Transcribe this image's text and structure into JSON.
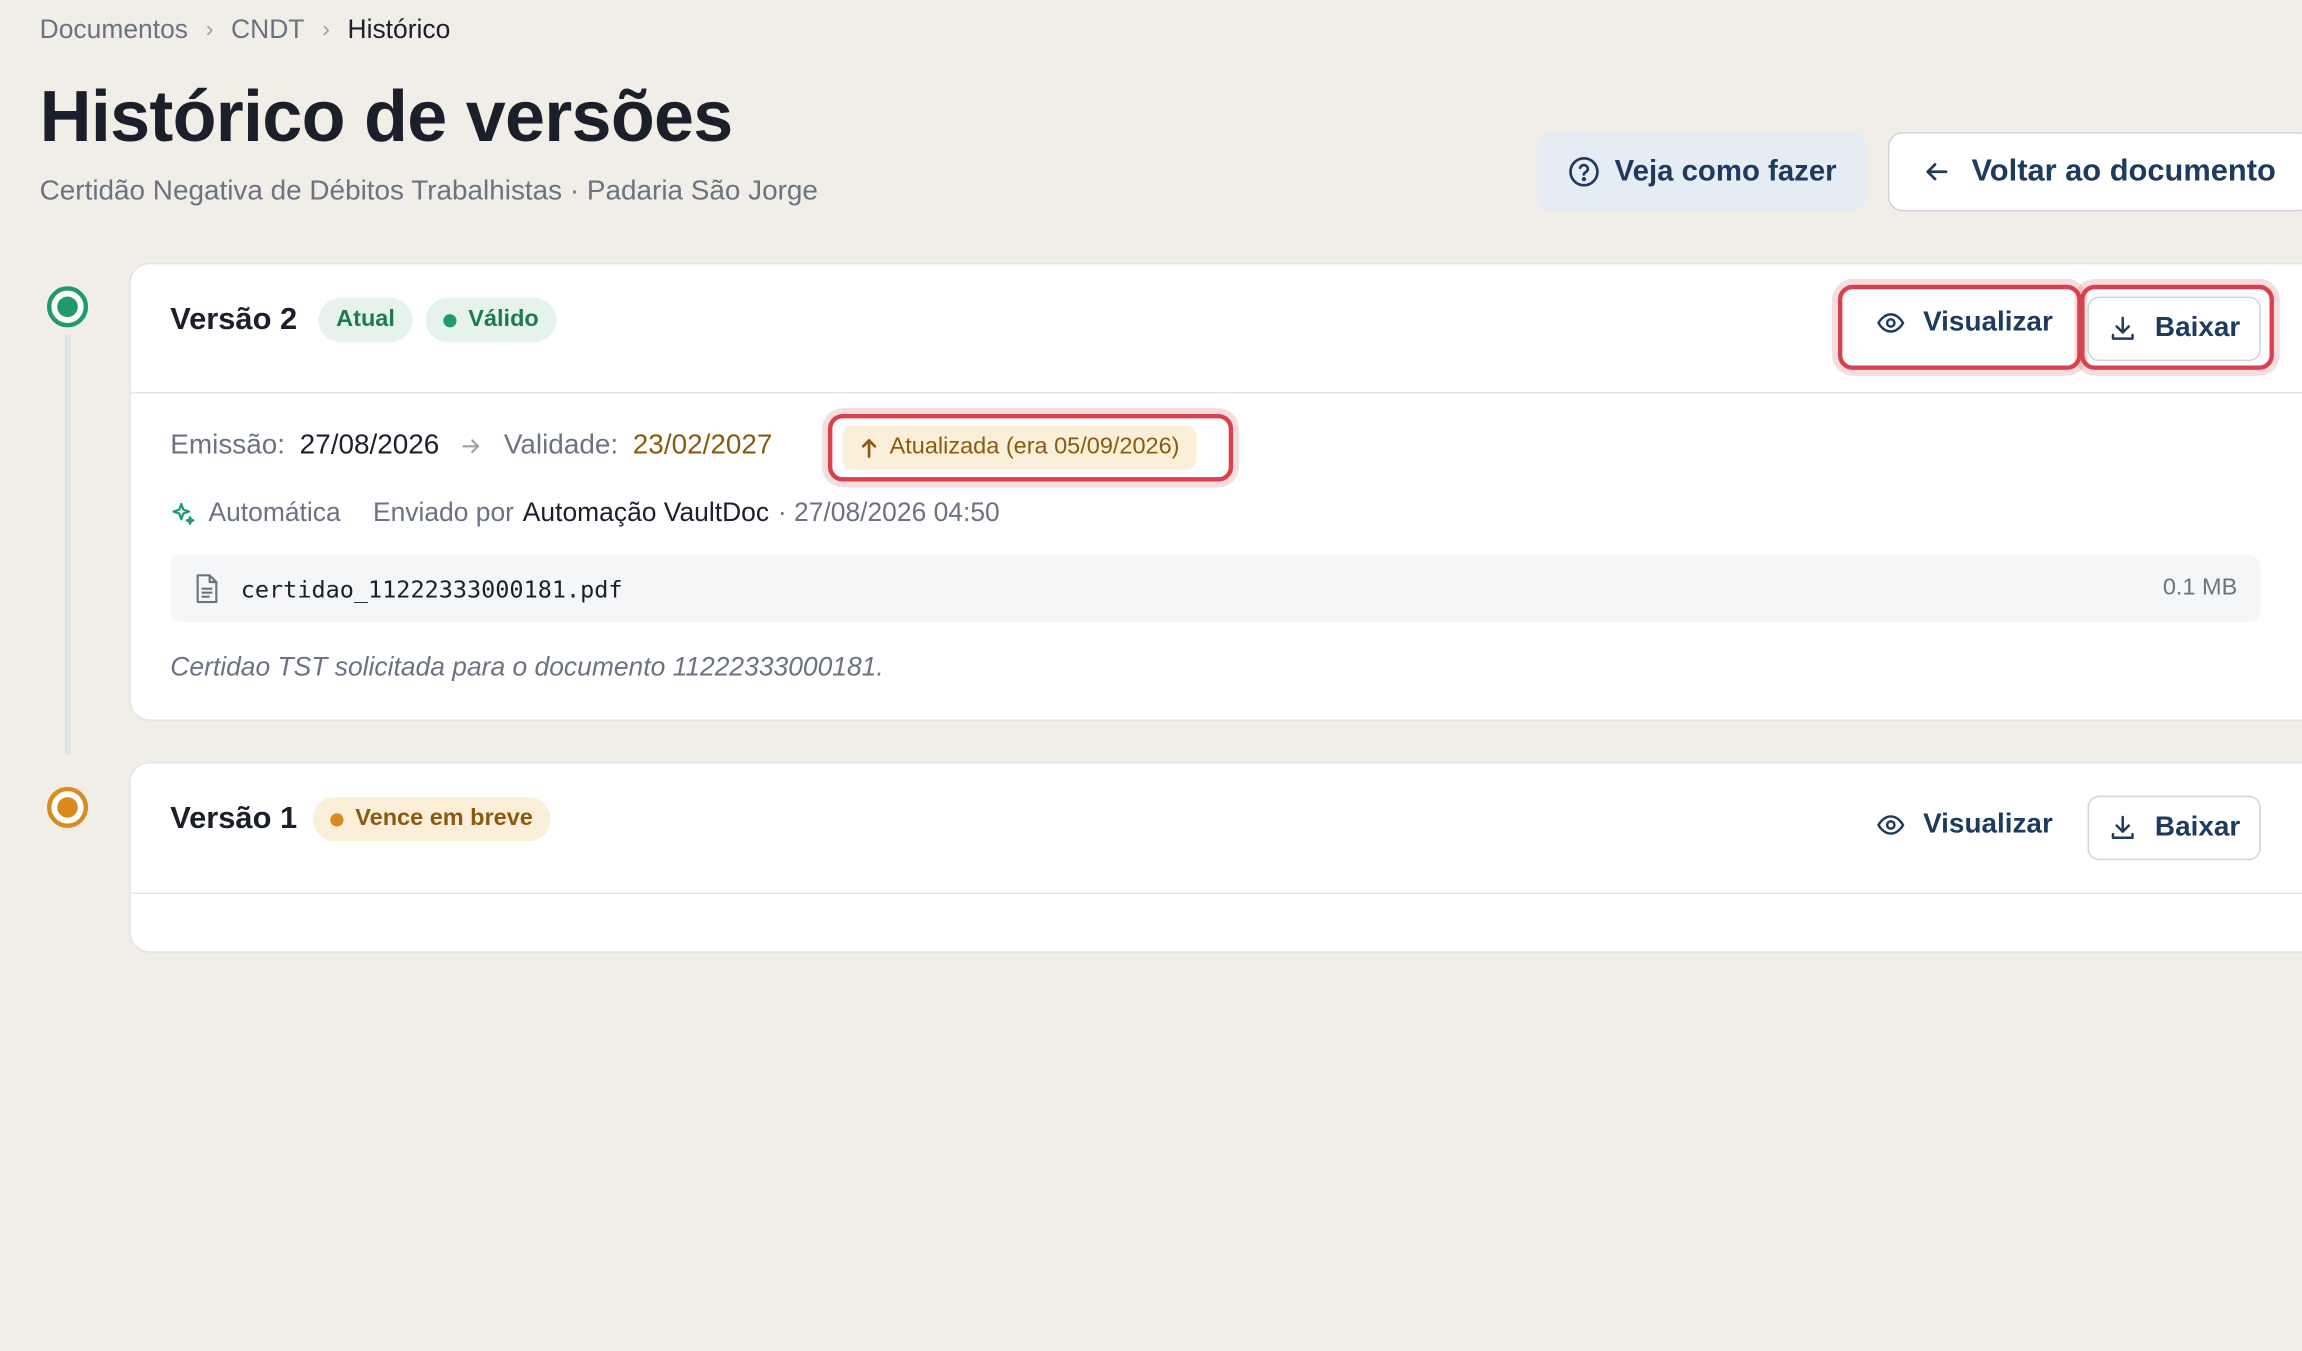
{
  "breadcrumb": {
    "items": [
      "Documentos",
      "CNDT",
      "Histórico"
    ],
    "separator": "›"
  },
  "page": {
    "title": "Histórico de versões",
    "subtitle": "Certidão Negativa de Débitos Trabalhistas · Padaria São Jorge"
  },
  "header_actions": {
    "help_label": "Veja como fazer",
    "back_label": "Voltar ao documento",
    "help_icon": "question-circle-icon",
    "back_icon": "arrow-left-icon"
  },
  "versions": [
    {
      "title": "Versão 2",
      "badges": {
        "current": "Atual",
        "status": "Válido"
      },
      "actions": {
        "view": "Visualizar",
        "download": "Baixar"
      },
      "emission_label": "Emissão:",
      "emission_value": "27/08/2026",
      "validity_label": "Validade:",
      "validity_value": "23/02/2027",
      "update_badge": "Atualizada (era 05/09/2026)",
      "mode": "Automática",
      "sent_by_label": "Enviado por",
      "sent_by": "Automação VaultDoc",
      "sent_at": "· 27/08/2026 04:50",
      "file_name": "certidao_11222333000181.pdf",
      "file_size": "0.1 MB",
      "note": "Certidao TST solicitada para o documento 11222333000181."
    },
    {
      "title": "Versão 1",
      "badges": {
        "status": "Vence em breve"
      },
      "actions": {
        "view": "Visualizar",
        "download": "Baixar"
      }
    }
  ],
  "colors": {
    "background": "#f1eee8",
    "valid_green": "#1f9a6c",
    "warning_orange": "#d98b1e",
    "highlight_red": "#d9414e",
    "primary_navy": "#1e3a5f"
  }
}
